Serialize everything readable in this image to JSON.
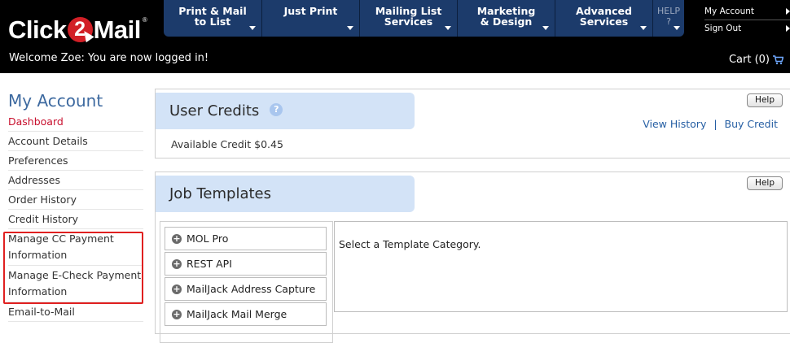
{
  "header": {
    "logo": {
      "left": "Click",
      "two": "2",
      "right": "Mail",
      "tm": "®"
    },
    "welcome": "Welcome Zoe: You are now logged in!",
    "nav": [
      {
        "label": "Print & Mail\nto List"
      },
      {
        "label": "Just Print"
      },
      {
        "label": "Mailing List\nServices"
      },
      {
        "label": "Marketing\n& Design"
      },
      {
        "label": "Advanced\nServices"
      }
    ],
    "help": {
      "line1": "HELP",
      "line2": "?"
    },
    "account_links": {
      "my_account": "My Account",
      "sign_out": "Sign Out"
    },
    "cart": {
      "label": "Cart (0)",
      "icon": "cart-icon"
    }
  },
  "sidebar": {
    "title": "My Account",
    "items": [
      {
        "label": "Dashboard",
        "active": true
      },
      {
        "label": "Account Details"
      },
      {
        "label": "Preferences"
      },
      {
        "label": "Addresses"
      },
      {
        "label": "Order History"
      },
      {
        "label": "Credit History"
      },
      {
        "label": "Manage CC Payment\nInformation"
      },
      {
        "label": "Manage E-Check Payment\nInformation"
      },
      {
        "label": "Email-to-Mail"
      }
    ]
  },
  "user_credits": {
    "title": "User Credits",
    "info_icon": "?",
    "help_label": "Help",
    "view_history": "View History",
    "separator": "|",
    "buy_credit": "Buy Credit",
    "available": "Available Credit $0.45"
  },
  "job_templates": {
    "title": "Job Templates",
    "help_label": "Help",
    "categories": [
      {
        "label": "MOL Pro"
      },
      {
        "label": "REST API"
      },
      {
        "label": "MailJack Address Capture"
      },
      {
        "label": "MailJack Mail Merge"
      }
    ],
    "prompt": "Select a Template Category."
  },
  "colors": {
    "header_bg": "#000000",
    "nav_bg": "#1c3b6b",
    "accent_red": "#c8102e",
    "link_blue": "#255ea3",
    "tab_bg": "#d3e3f7",
    "highlight_red": "#e02020"
  }
}
